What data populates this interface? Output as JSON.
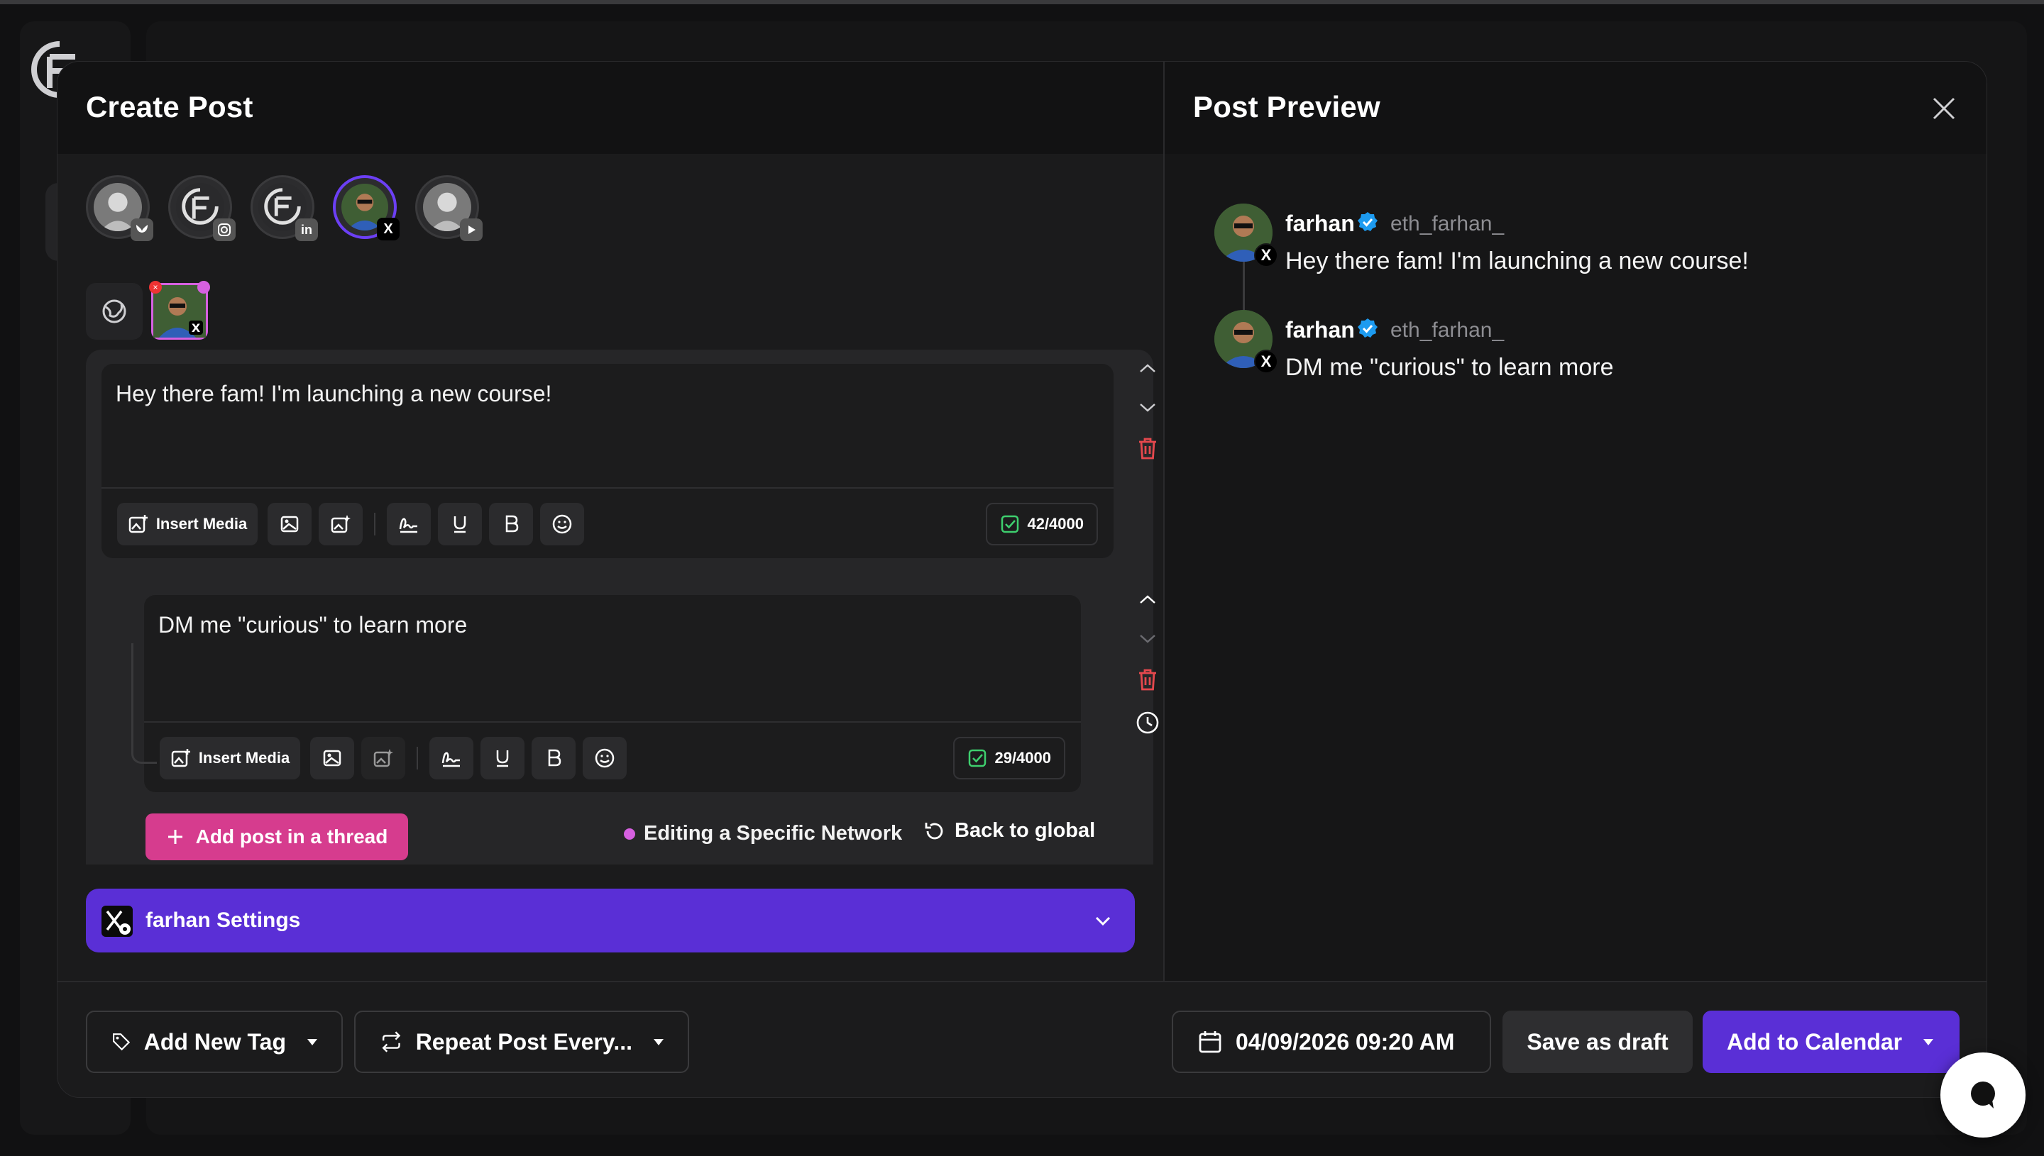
{
  "modal": {
    "create_title": "Create Post",
    "preview_title": "Post Preview"
  },
  "accounts": [
    {
      "name": "account-bluesky",
      "badge": "🦋",
      "badge_color": "#555555"
    },
    {
      "name": "account-instagram",
      "badge": "◎",
      "badge_color": "#555555"
    },
    {
      "name": "account-linkedin",
      "badge": "in",
      "badge_color": "#555555"
    },
    {
      "name": "account-x",
      "badge": "X",
      "badge_color": "#000000",
      "selected": true
    },
    {
      "name": "account-youtube",
      "badge": "▶",
      "badge_color": "#555555"
    }
  ],
  "posts": [
    {
      "text": "Hey there fam! I'm launching a new course!",
      "insert_media": "Insert Media",
      "counter": "42/4000"
    },
    {
      "text": "DM me \"curious\" to learn more",
      "insert_media": "Insert Media",
      "counter": "29/4000"
    }
  ],
  "thread": {
    "add_label": "Add post in a thread",
    "editing_label": "Editing a Specific Network",
    "back_label": "Back to global"
  },
  "settings": {
    "label": "farhan Settings"
  },
  "preview": [
    {
      "name": "farhan",
      "handle": "eth_farhan_",
      "text": "Hey there fam! I'm launching a new course!"
    },
    {
      "name": "farhan",
      "handle": "eth_farhan_",
      "text": "DM me \"curious\" to learn more"
    }
  ],
  "bottom": {
    "add_tag": "Add New Tag",
    "repeat": "Repeat Post Every...",
    "datetime": "04/09/2026 09:20 AM",
    "save_draft": "Save as draft",
    "add_calendar": "Add to Calendar"
  },
  "colors": {
    "accent_purple": "#5a2fd6",
    "accent_pink": "#d63c8e",
    "delete_red": "#e5484d",
    "verified_blue": "#1d9bf0",
    "counter_green": "#3ecf6e"
  }
}
